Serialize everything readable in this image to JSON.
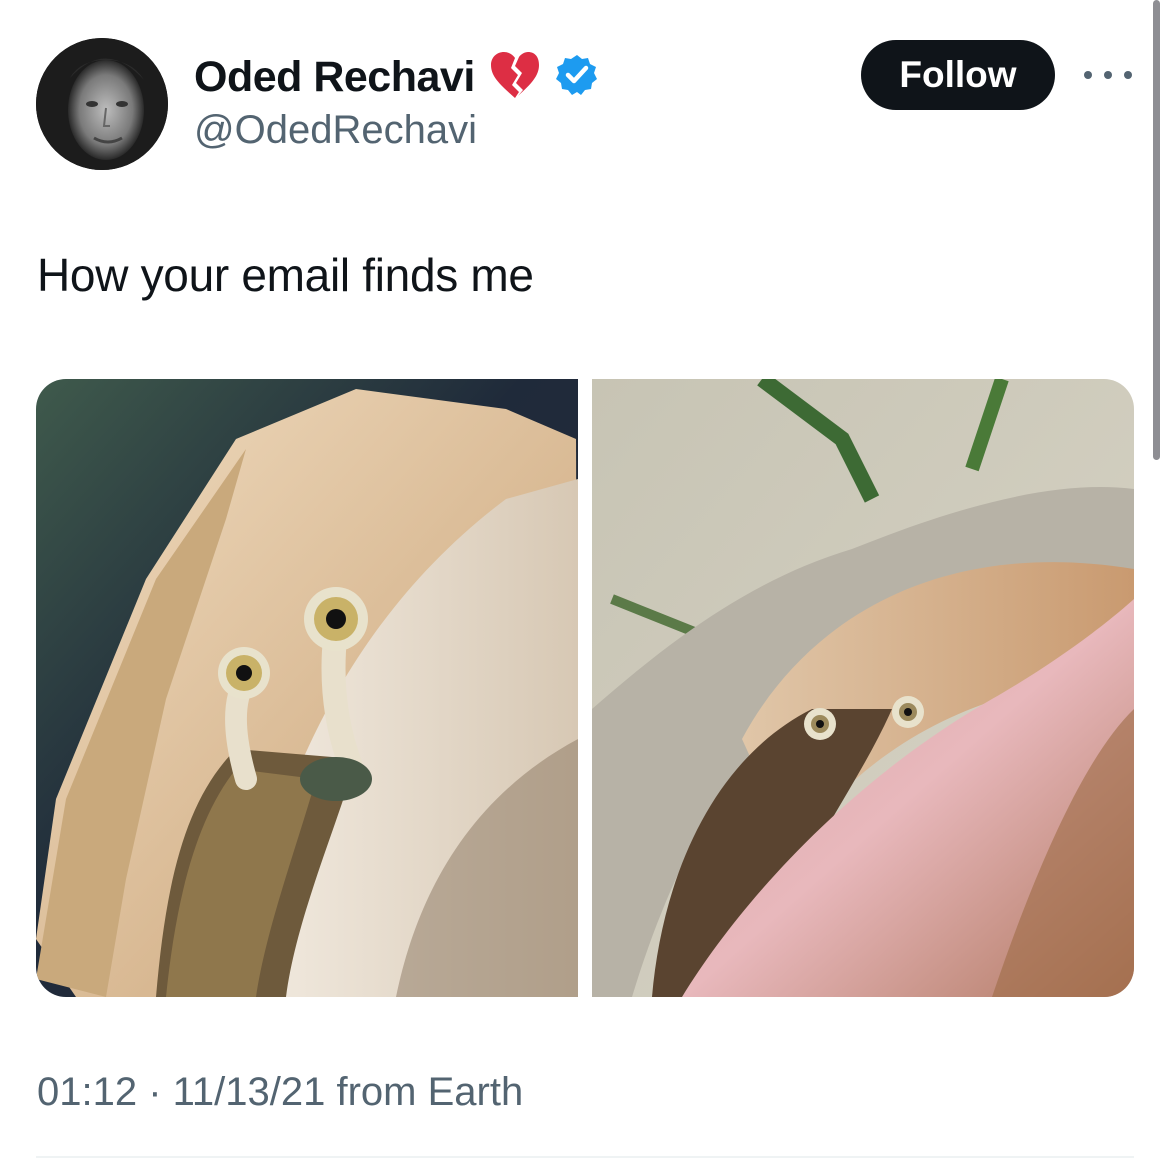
{
  "author": {
    "display_name": "Oded Rechavi",
    "handle": "@OdedRechavi",
    "avatar_icon": "avatar-photo",
    "status_emoji_icon": "broken-heart-icon",
    "verified_icon": "verified-badge-icon",
    "verified_color": "#1d9bf0"
  },
  "actions": {
    "follow_label": "Follow",
    "more_icon": "more-options-icon"
  },
  "tweet": {
    "text": "How your email finds me",
    "media": [
      {
        "icon": "photo",
        "description_icon": "snail-photo-1"
      },
      {
        "icon": "photo",
        "description_icon": "snail-photo-2"
      }
    ]
  },
  "meta": {
    "line": "01:12 · 11/13/21 from Earth"
  },
  "colors": {
    "text": "#0f1419",
    "secondary": "#536471",
    "button_bg": "#0f1419",
    "verified": "#1d9bf0",
    "broken_heart": "#dd2e44"
  }
}
